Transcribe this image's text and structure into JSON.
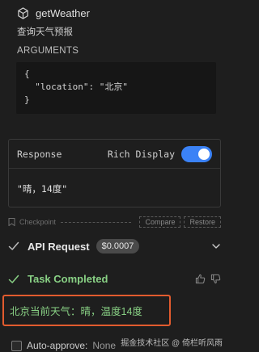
{
  "tool": {
    "name": "getWeather",
    "description": "查询天气预报",
    "args_label": "ARGUMENTS",
    "args_lines": [
      "{",
      "  \"location\": \"北京\"",
      "}"
    ]
  },
  "response": {
    "label": "Response",
    "rich_display_label": "Rich Display",
    "rich_display_on": true,
    "body": "\"晴，14度\""
  },
  "checkpoint": {
    "label": "Checkpoint",
    "compare_label": "Compare",
    "restore_label": "Restore"
  },
  "api_request": {
    "title": "API Request",
    "cost": "$0.0007"
  },
  "task": {
    "title": "Task Completed",
    "result": "北京当前天气：晴，温度14度"
  },
  "auto_approve": {
    "label": "Auto-approve:",
    "value": "None"
  },
  "watermark": "掘金技术社区 @ 倚栏听风雨",
  "colors": {
    "accent": "#3b82f6",
    "success": "#89d185",
    "highlight_border": "#e25b2e"
  }
}
